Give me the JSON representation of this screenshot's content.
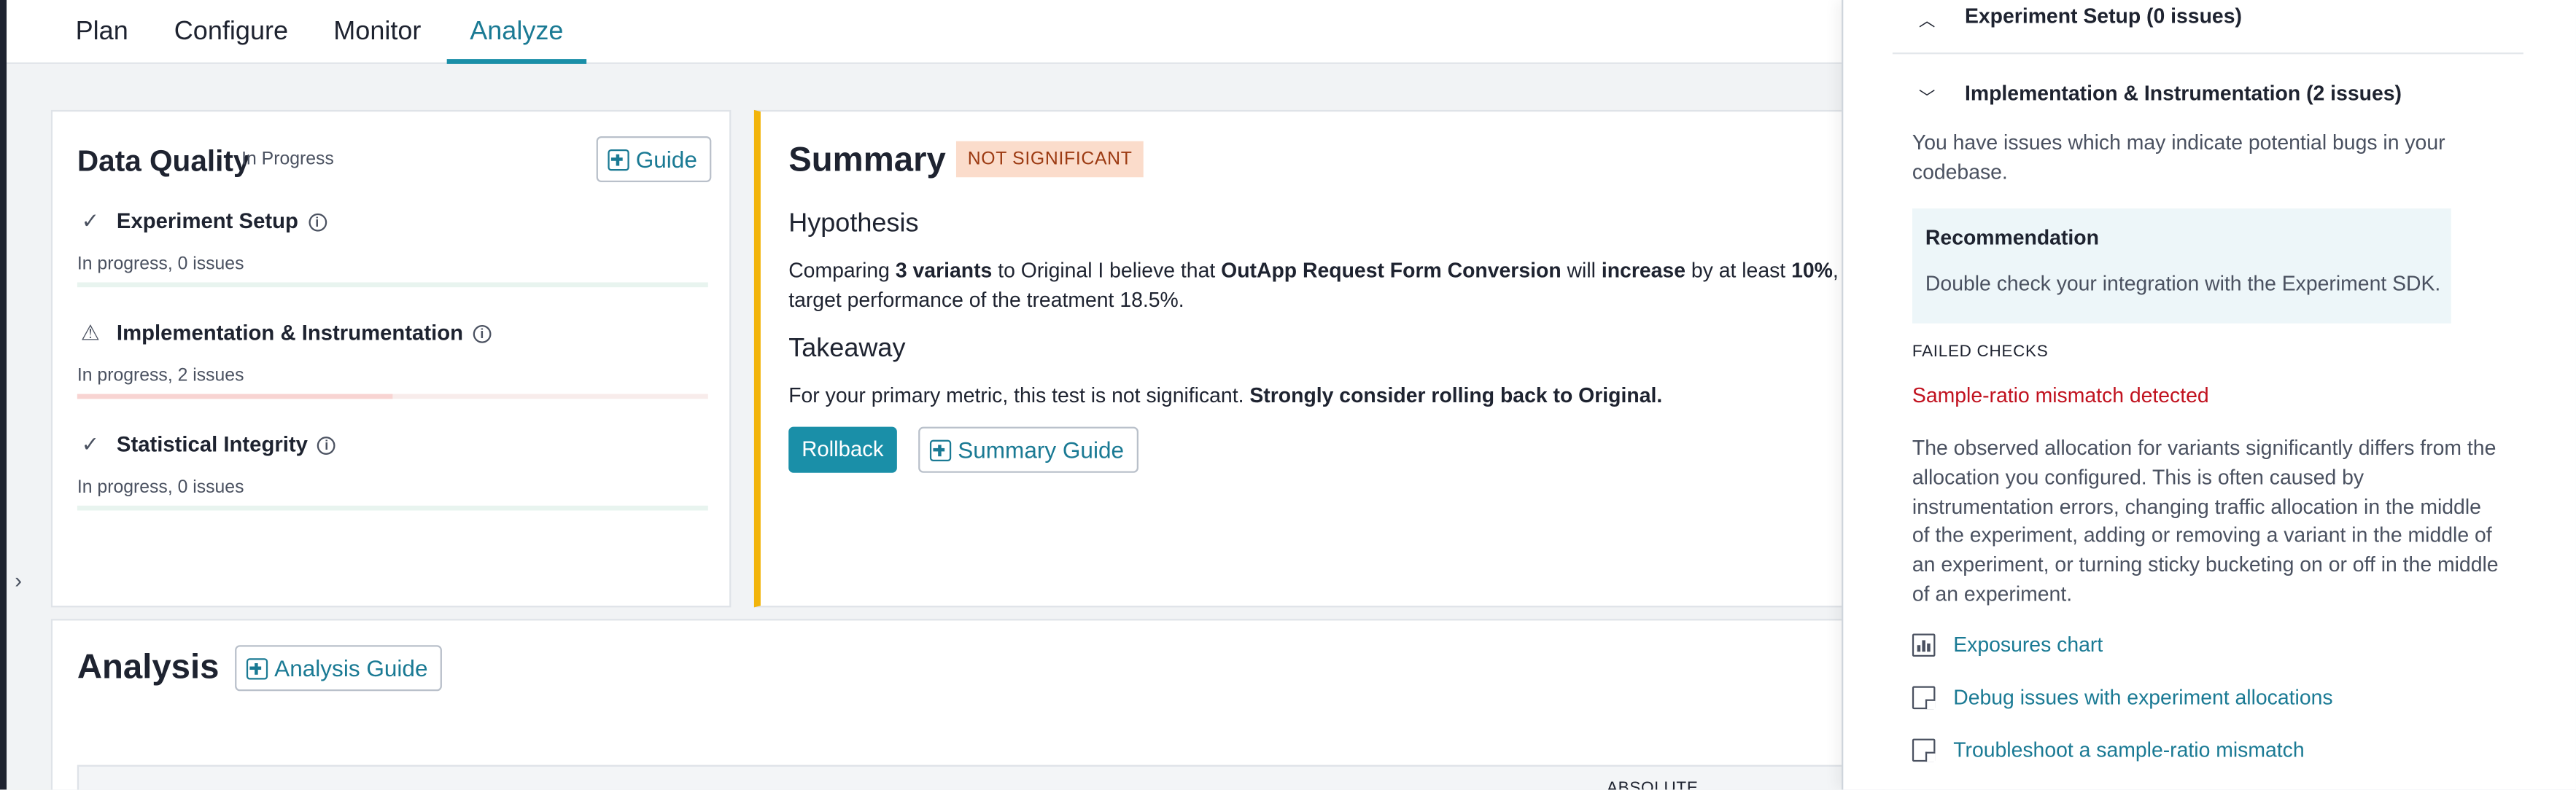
{
  "nav": {
    "tabs": [
      {
        "label": "Plan"
      },
      {
        "label": "Configure"
      },
      {
        "label": "Monitor"
      },
      {
        "label": "Analyze",
        "active": true
      }
    ]
  },
  "data_quality": {
    "title": "Data Quality",
    "status": "In Progress",
    "guide_label": "Guide",
    "checks": [
      {
        "icon": "check-icon",
        "label": "Experiment Setup",
        "status": "In progress, 0 issues",
        "level": "ok",
        "issue_fraction": 0
      },
      {
        "icon": "warning-icon",
        "label": "Implementation & Instrumentation",
        "status": "In progress, 2 issues",
        "level": "warn",
        "issue_fraction": 0.5
      },
      {
        "icon": "check-icon",
        "label": "Statistical Integrity",
        "status": "In progress, 0 issues",
        "level": "ok",
        "issue_fraction": 0
      }
    ]
  },
  "summary": {
    "title": "Summary",
    "badge": "NOT SIGNIFICANT",
    "hypothesis_heading": "Hypothesis",
    "hypothesis_line1": {
      "p1": "Comparing ",
      "b1": "3 variants",
      "p2": " to Original I believe that ",
      "b2": "OutApp Request Form Conversion",
      "p3": " will  ",
      "b3": "increase",
      "p4": " by at least ",
      "b4": "10%",
      "p5": ", r"
    },
    "hypothesis_line2": "target performance of the treatment 18.5%.",
    "takeaway_heading": "Takeaway",
    "takeaway_text": "For your primary metric, this test is not significant. ",
    "takeaway_bold": "Strongly consider rolling back to Original.",
    "rollback_label": "Rollback",
    "summary_guide_label": "Summary Guide"
  },
  "analysis": {
    "title": "Analysis",
    "guide_label": "Analysis Guide",
    "table_header_absolute": "ABSOLUTE"
  },
  "panel": {
    "sections": [
      {
        "label": "Experiment Setup (0 issues)",
        "expanded": false
      },
      {
        "label": "Implementation & Instrumentation (2 issues)",
        "expanded": true
      }
    ],
    "intro": "You have issues which may indicate potential bugs in your codebase.",
    "recommendation_title": "Recommendation",
    "recommendation_text": "Double check your integration with the Experiment SDK.",
    "failed_checks_label": "FAILED CHECKS",
    "failed_check_name": "Sample-ratio mismatch detected",
    "failed_check_description": "The observed allocation for variants significantly differs from the allocation you configured. This is often caused by instrumentation errors, changing traffic allocation in the middle of the experiment, adding or removing a variant in the middle of an experiment, or turning sticky bucketing on or off in the middle of an experiment.",
    "links": [
      {
        "icon": "bar-chart-icon",
        "label": "Exposures chart"
      },
      {
        "icon": "document-icon",
        "label": "Debug issues with experiment allocations"
      },
      {
        "icon": "document-icon",
        "label": "Troubleshoot a sample-ratio mismatch"
      }
    ]
  },
  "colors": {
    "accent": "#1a8fa8",
    "summary_border": "#f2b40a",
    "badge_bg": "#fbdccb",
    "error": "#c1121f"
  }
}
